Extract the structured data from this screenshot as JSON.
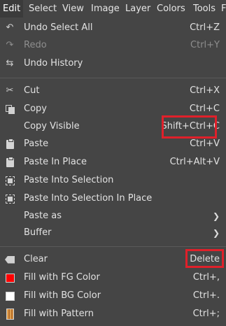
{
  "menubar": {
    "items": [
      "Edit",
      "Select",
      "View",
      "Image",
      "Layer",
      "Colors",
      "Tools",
      "F"
    ],
    "active": "Edit"
  },
  "menu": {
    "undo_select_all": {
      "label": "Undo Select All",
      "accel": "Ctrl+Z",
      "icon": "undo-icon",
      "enabled": true
    },
    "redo": {
      "label": "Redo",
      "accel": "Ctrl+Y",
      "icon": "redo-icon",
      "enabled": false
    },
    "undo_history": {
      "label": "Undo History",
      "icon": "undo-history-icon",
      "enabled": true
    },
    "cut": {
      "label": "Cut",
      "accel": "Ctrl+X",
      "icon": "scissors-icon"
    },
    "copy": {
      "label": "Copy",
      "accel": "Ctrl+C",
      "icon": "copy-icon"
    },
    "copy_visible": {
      "label": "Copy Visible",
      "accel": "Shift+Ctrl+C"
    },
    "paste": {
      "label": "Paste",
      "accel": "Ctrl+V",
      "icon": "clipboard-icon"
    },
    "paste_in_place": {
      "label": "Paste In Place",
      "accel": "Ctrl+Alt+V",
      "icon": "clipboard-icon"
    },
    "paste_into_selection": {
      "label": "Paste Into Selection",
      "icon": "selection-icon"
    },
    "paste_into_selection_in_place": {
      "label": "Paste Into Selection In Place",
      "icon": "selection-icon"
    },
    "paste_as": {
      "label": "Paste as",
      "submenu_glyph": "❯"
    },
    "buffer": {
      "label": "Buffer",
      "submenu_glyph": "❯"
    },
    "clear": {
      "label": "Clear",
      "accel": "Delete",
      "icon": "clear-icon"
    },
    "fill_fg": {
      "label": "Fill with FG Color",
      "accel": "Ctrl+,",
      "swatch_color": "#ff0000"
    },
    "fill_bg": {
      "label": "Fill with BG Color",
      "accel": "Ctrl+.",
      "swatch_color": "#ffffff"
    },
    "fill_pattern": {
      "label": "Fill with Pattern",
      "accel": "Ctrl+;",
      "icon": "pattern-icon"
    }
  },
  "icons": {
    "undo": "↶",
    "redo": "↷",
    "undo_history": "⇆",
    "cut": "✂"
  },
  "highlight_color": "#e0202a"
}
